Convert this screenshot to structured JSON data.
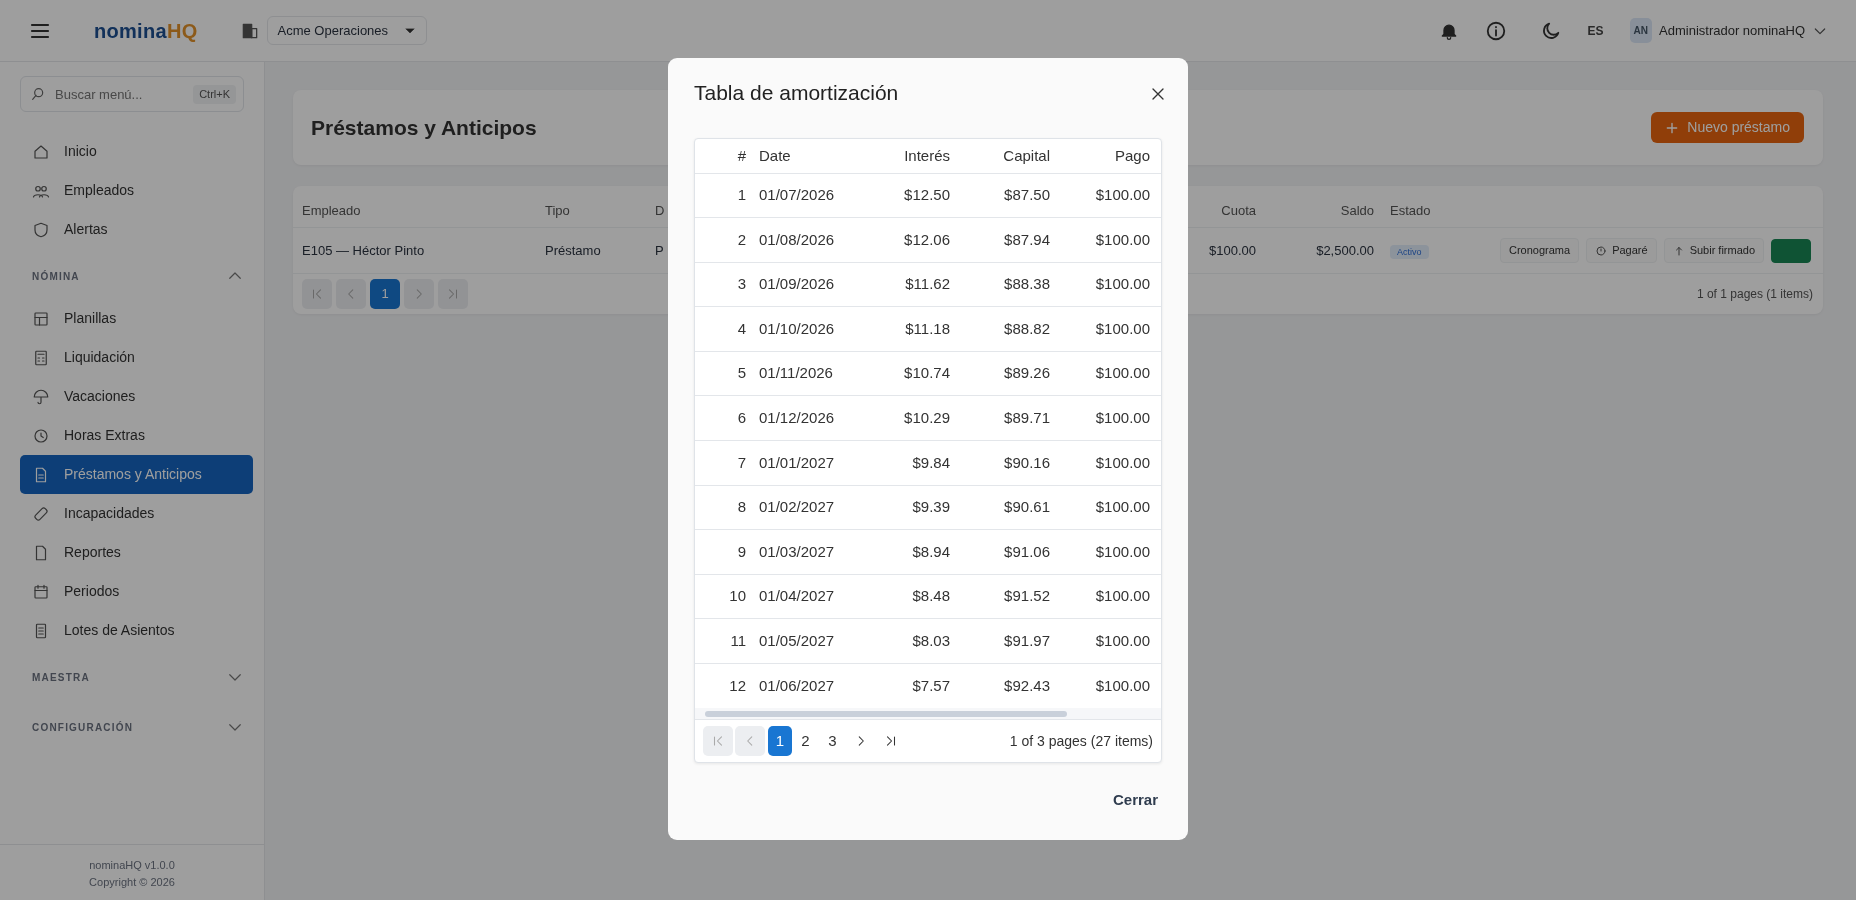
{
  "topbar": {
    "brand": {
      "primary": "nomina",
      "accent": "HQ"
    },
    "company": "Acme Operaciones",
    "language": "ES",
    "avatar": "AN",
    "user": "Administrador nominaHQ"
  },
  "sidebar": {
    "search": {
      "placeholder": "Buscar menú...",
      "shortcut": "Ctrl+K"
    },
    "items": [
      {
        "label": "Inicio",
        "selected": false
      },
      {
        "label": "Empleados",
        "selected": false
      },
      {
        "label": "Alertas",
        "selected": false
      }
    ],
    "sections": [
      {
        "label": "NÓMINA",
        "expanded": true,
        "children": [
          {
            "label": "Planillas",
            "selected": false
          },
          {
            "label": "Liquidación",
            "selected": false
          },
          {
            "label": "Vacaciones",
            "selected": false
          },
          {
            "label": "Horas Extras",
            "selected": false
          },
          {
            "label": "Préstamos y Anticipos",
            "selected": true
          },
          {
            "label": "Incapacidades",
            "selected": false
          },
          {
            "label": "Reportes",
            "selected": false
          },
          {
            "label": "Periodos",
            "selected": false
          },
          {
            "label": "Lotes de Asientos",
            "selected": false
          }
        ]
      },
      {
        "label": "MAESTRA",
        "expanded": false
      },
      {
        "label": "CONFIGURACIÓN",
        "expanded": false
      }
    ],
    "footer": [
      "nominaHQ v1.0.0",
      "Copyright © 2026"
    ]
  },
  "page": {
    "title": "Préstamos y Anticipos",
    "primary_button": "Nuevo préstamo",
    "table": {
      "columns": [
        "Empleado",
        "Tipo",
        "D",
        "Cuota",
        "Saldo",
        "Estado"
      ],
      "rows": [
        {
          "cells": [
            "E105 — Héctor Pinto",
            "Préstamo",
            "P",
            "$100.00",
            "$2,500.00"
          ],
          "status": "Activo",
          "actions": [
            {
              "label": "Cronograma",
              "kind": "plain"
            },
            {
              "label": "Pagaré",
              "kind": "icon"
            },
            {
              "label": "Subir firmado",
              "kind": "icon"
            },
            {
              "kind": "success"
            }
          ]
        }
      ],
      "pager": {
        "pages": [
          {
            "label": "1",
            "selected": true
          }
        ],
        "summary": "1 of 1 pages (1 items)"
      }
    }
  },
  "modal": {
    "title": "Tabla de amortización",
    "columns": [
      "#",
      "Date",
      "Interés",
      "Capital",
      "Pago"
    ],
    "rows": [
      [
        "1",
        "01/07/2026",
        "$12.50",
        "$87.50",
        "$100.00"
      ],
      [
        "2",
        "01/08/2026",
        "$12.06",
        "$87.94",
        "$100.00"
      ],
      [
        "3",
        "01/09/2026",
        "$11.62",
        "$88.38",
        "$100.00"
      ],
      [
        "4",
        "01/10/2026",
        "$11.18",
        "$88.82",
        "$100.00"
      ],
      [
        "5",
        "01/11/2026",
        "$10.74",
        "$89.26",
        "$100.00"
      ],
      [
        "6",
        "01/12/2026",
        "$10.29",
        "$89.71",
        "$100.00"
      ],
      [
        "7",
        "01/01/2027",
        "$9.84",
        "$90.16",
        "$100.00"
      ],
      [
        "8",
        "01/02/2027",
        "$9.39",
        "$90.61",
        "$100.00"
      ],
      [
        "9",
        "01/03/2027",
        "$8.94",
        "$91.06",
        "$100.00"
      ],
      [
        "10",
        "01/04/2027",
        "$8.48",
        "$91.52",
        "$100.00"
      ],
      [
        "11",
        "01/05/2027",
        "$8.03",
        "$91.97",
        "$100.00"
      ],
      [
        "12",
        "01/06/2027",
        "$7.57",
        "$92.43",
        "$100.00"
      ]
    ],
    "pager": {
      "first": {
        "disabled": true
      },
      "prev": {
        "disabled": true
      },
      "pages": [
        {
          "label": "1",
          "selected": true
        },
        {
          "label": "2",
          "selected": false
        },
        {
          "label": "3",
          "selected": false
        }
      ],
      "next": {
        "disabled": false
      },
      "last": {
        "disabled": false
      },
      "summary": "1 of 3 pages (27 items)"
    },
    "footer_button": "Cerrar"
  }
}
